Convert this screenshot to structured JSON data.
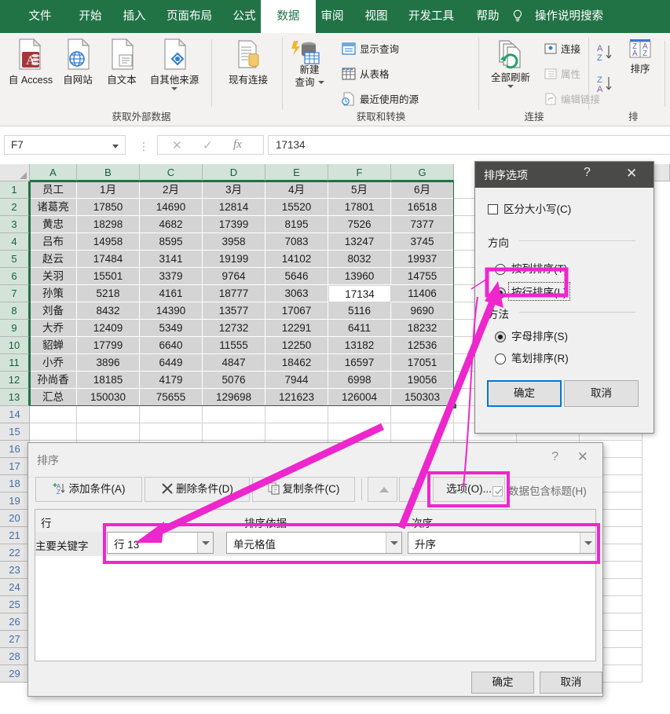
{
  "ribbon": {
    "tabs": [
      {
        "label": "文件",
        "active": false
      },
      {
        "label": "开始",
        "active": false
      },
      {
        "label": "插入",
        "active": false
      },
      {
        "label": "页面布局",
        "active": false
      },
      {
        "label": "公式",
        "active": false
      },
      {
        "label": "数据",
        "active": true
      },
      {
        "label": "审阅",
        "active": false
      },
      {
        "label": "视图",
        "active": false
      },
      {
        "label": "开发工具",
        "active": false
      },
      {
        "label": "帮助",
        "active": false
      }
    ],
    "search_label": "操作说明搜索",
    "groups": [
      {
        "title": "获取外部数据"
      },
      {
        "title": "获取和转换"
      },
      {
        "title": "连接"
      },
      {
        "title": "排"
      }
    ],
    "get_external": [
      {
        "label": "自 Access",
        "icon": "access-icon"
      },
      {
        "label": "自网站",
        "icon": "web-icon"
      },
      {
        "label": "自文本",
        "icon": "text-icon"
      },
      {
        "label": "自其他来源",
        "icon": "other-sources-icon"
      },
      {
        "label": "现有连接",
        "icon": "existing-connections-icon"
      }
    ],
    "get_transform": {
      "new_query": "新建\n查询",
      "new_query_line1": "新建",
      "new_query_line2": "查询",
      "items": [
        {
          "label": "显示查询",
          "icon": "show-queries-icon"
        },
        {
          "label": "从表格",
          "icon": "from-table-icon"
        },
        {
          "label": "最近使用的源",
          "icon": "recent-sources-icon"
        }
      ]
    },
    "connections": {
      "refresh_all": "全部刷新",
      "items": [
        {
          "label": "连接",
          "icon": "connections-icon",
          "disabled": false
        },
        {
          "label": "属性",
          "icon": "properties-icon",
          "disabled": true
        },
        {
          "label": "编辑链接",
          "icon": "edit-links-icon",
          "disabled": true
        }
      ]
    },
    "sort_group": {
      "sort_az": "A-Z",
      "sort_za": "Z-A",
      "sort_label": "排序"
    }
  },
  "formula_bar": {
    "name_box": "F7",
    "value": "17134",
    "cancel_icon": "close-icon",
    "confirm_icon": "check-icon",
    "function_icon": "fx-icon"
  },
  "grid": {
    "columns": [
      "A",
      "B",
      "C",
      "D",
      "E",
      "F",
      "G"
    ],
    "rows": [
      1,
      2,
      3,
      4,
      5,
      6,
      7,
      8,
      9,
      10,
      11,
      12,
      13,
      14,
      15,
      16,
      17,
      18,
      19,
      20,
      21,
      22,
      23,
      24,
      25,
      26,
      27,
      28,
      29
    ],
    "active_cell": "F7",
    "data": [
      [
        "员工",
        "1月",
        "2月",
        "3月",
        "4月",
        "5月",
        "6月"
      ],
      [
        "诸葛亮",
        "17850",
        "14690",
        "12814",
        "15520",
        "17801",
        "16518"
      ],
      [
        "黄忠",
        "18298",
        "4682",
        "17399",
        "8195",
        "7526",
        "7377"
      ],
      [
        "吕布",
        "14958",
        "8595",
        "3958",
        "7083",
        "13247",
        "3745"
      ],
      [
        "赵云",
        "17484",
        "3141",
        "19199",
        "14102",
        "8032",
        "19937"
      ],
      [
        "关羽",
        "15501",
        "3379",
        "9764",
        "5646",
        "13960",
        "14755"
      ],
      [
        "孙策",
        "5218",
        "4161",
        "18777",
        "3063",
        "17134",
        "11406"
      ],
      [
        "刘备",
        "8432",
        "14390",
        "13577",
        "17067",
        "5116",
        "9690"
      ],
      [
        "大乔",
        "12409",
        "5349",
        "12732",
        "12291",
        "6411",
        "18232"
      ],
      [
        "貂蝉",
        "17799",
        "6640",
        "11555",
        "12250",
        "13182",
        "12536"
      ],
      [
        "小乔",
        "3896",
        "6449",
        "4847",
        "18462",
        "16597",
        "17051"
      ],
      [
        "孙尚香",
        "18185",
        "4179",
        "5076",
        "7944",
        "6998",
        "19056"
      ],
      [
        "汇总",
        "150030",
        "75655",
        "129698",
        "121623",
        "126004",
        "150303"
      ]
    ]
  },
  "sort_options_dialog": {
    "title": "排序选项",
    "help_icon": "?",
    "close_icon": "✕",
    "case_sensitive": {
      "label": "区分大小写(C)",
      "checked": false
    },
    "direction_group": "方向",
    "direction_options": [
      {
        "label": "按列排序(T)",
        "selected": false
      },
      {
        "label": "按行排序(L)",
        "selected": true,
        "focused": true
      }
    ],
    "method_group": "方法",
    "method_options": [
      {
        "label": "字母排序(S)",
        "selected": true
      },
      {
        "label": "笔划排序(R)",
        "selected": false
      }
    ],
    "ok_label": "确定",
    "cancel_label": "取消"
  },
  "sort_dialog": {
    "title": "排序",
    "help_icon": "?",
    "close_icon": "✕",
    "toolbar": [
      {
        "label": "添加条件(A)",
        "icon": "add-level-icon"
      },
      {
        "label": "删除条件(D)",
        "icon": "delete-level-icon"
      },
      {
        "label": "复制条件(C)",
        "icon": "copy-level-icon"
      },
      {
        "label": "选项(O)...",
        "icon": "options-icon"
      }
    ],
    "move_up_icon": "triangle-up-icon",
    "move_down_icon": "triangle-down-icon",
    "header_checkbox": {
      "label": "数据包含标题(H)",
      "checked": true,
      "disabled": true
    },
    "column_headers": [
      "行",
      "排序依据",
      "次序"
    ],
    "levels": [
      {
        "prefix": "主要关键字",
        "key": "行 13",
        "sort_on": "单元格值",
        "order": "升序"
      }
    ],
    "ok_label": "确定",
    "cancel_label": "取消"
  },
  "annotations": {
    "highlight_color": "#ee26cd",
    "boxes": [
      {
        "name": "sort-by-row-radio-highlight"
      },
      {
        "name": "options-button-highlight"
      },
      {
        "name": "sort-level-row-highlight"
      }
    ],
    "arrows": [
      {
        "name": "arrow-to-sort-key-dropdown"
      },
      {
        "name": "arrow-to-by-row-radio"
      },
      {
        "name": "arrow-from-options-button"
      }
    ]
  }
}
